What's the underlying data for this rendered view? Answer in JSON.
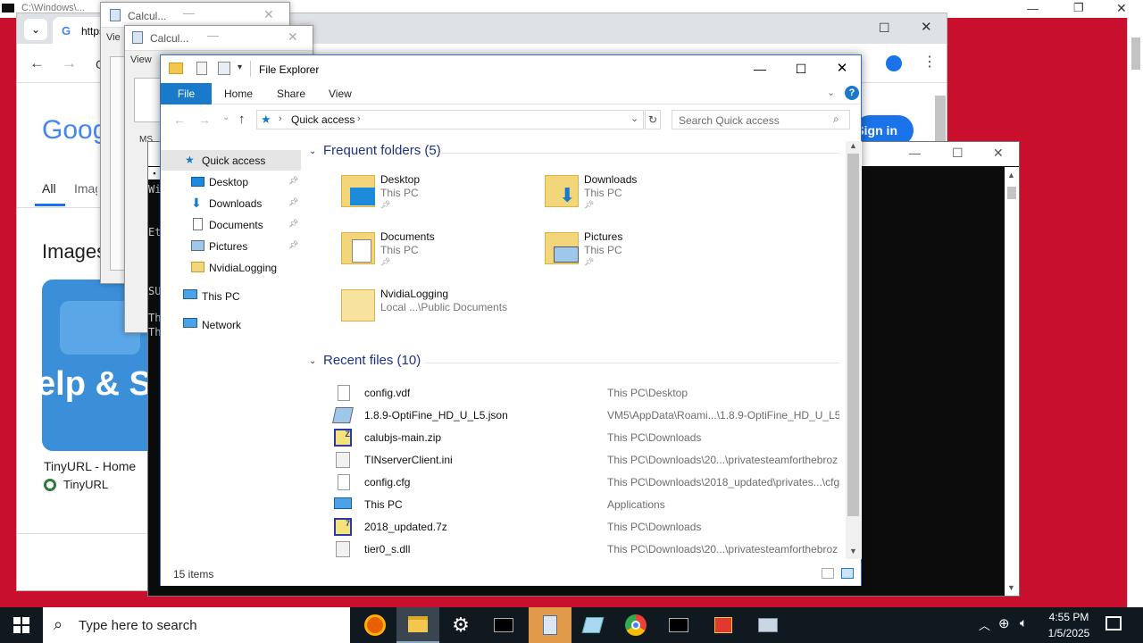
{
  "cmd_strip": {
    "title": "C:\\Windows\\..."
  },
  "chrome": {
    "tab_url_fragment": "https",
    "nav_partial": "G",
    "google_logo": "Goog",
    "filter_tabs": [
      "All",
      "Imag"
    ],
    "section_heading": "Images",
    "image_card_text": "elp & S",
    "result_title": "TinyURL - Home",
    "result_source": "TinyURL",
    "signin_label": "Sign in"
  },
  "calc_back": {
    "title": "Calcul...",
    "menu": "Vie"
  },
  "calc_front": {
    "title": "Calcul...",
    "menu": "View",
    "keys": [
      "MC",
      "MS"
    ]
  },
  "terminal": {
    "lines": [
      "Wi",
      "Et",
      "SU",
      "Th",
      "Th"
    ]
  },
  "explorer": {
    "title": "File Explorer",
    "ribbon_tabs": {
      "file": "File",
      "home": "Home",
      "share": "Share",
      "view": "View"
    },
    "address": "Quick access",
    "search_placeholder": "Search Quick access",
    "nav": {
      "quick_access": "Quick access",
      "desktop": "Desktop",
      "downloads": "Downloads",
      "documents": "Documents",
      "pictures": "Pictures",
      "nvidialogging": "NvidiaLogging",
      "this_pc": "This PC",
      "network": "Network"
    },
    "frequent_header": "Frequent folders (5)",
    "folders": [
      {
        "name": "Desktop",
        "sub": "This PC"
      },
      {
        "name": "Downloads",
        "sub": "This PC"
      },
      {
        "name": "Documents",
        "sub": "This PC"
      },
      {
        "name": "Pictures",
        "sub": "This PC"
      },
      {
        "name": "NvidiaLogging",
        "sub": "Local ...\\Public Documents"
      }
    ],
    "recent_header": "Recent files (10)",
    "recent": [
      {
        "name": "config.vdf",
        "path": "This PC\\Desktop",
        "icon": "file-icon"
      },
      {
        "name": "1.8.9-OptiFine_HD_U_L5.json",
        "path": "VM5\\AppData\\Roami...\\1.8.9-OptiFine_HD_U_L5",
        "icon": "json-icon"
      },
      {
        "name": "calubjs-main.zip",
        "path": "This PC\\Downloads",
        "icon": "archive-icon"
      },
      {
        "name": "TINserverClient.ini",
        "path": "This PC\\Downloads\\20...\\privatesteamforthebroz",
        "icon": "settings-file-icon"
      },
      {
        "name": "config.cfg",
        "path": "This PC\\Downloads\\2018_updated\\privates...\\cfg",
        "icon": "file-icon"
      },
      {
        "name": "This PC",
        "path": "Applications",
        "icon": "computer-icon"
      },
      {
        "name": "2018_updated.7z",
        "path": "This PC\\Downloads",
        "icon": "archive-icon"
      },
      {
        "name": "tier0_s.dll",
        "path": "This PC\\Downloads\\20...\\privatesteamforthebroz",
        "icon": "dll-icon"
      }
    ],
    "status_count": "15 items"
  },
  "taskbar": {
    "search_placeholder": "Type here to search",
    "time": "4:55 PM",
    "date": "1/5/2025"
  },
  "colors": {
    "desktop": "#c8102e",
    "accent": "#0078d7",
    "header_blue": "#1e3287"
  }
}
